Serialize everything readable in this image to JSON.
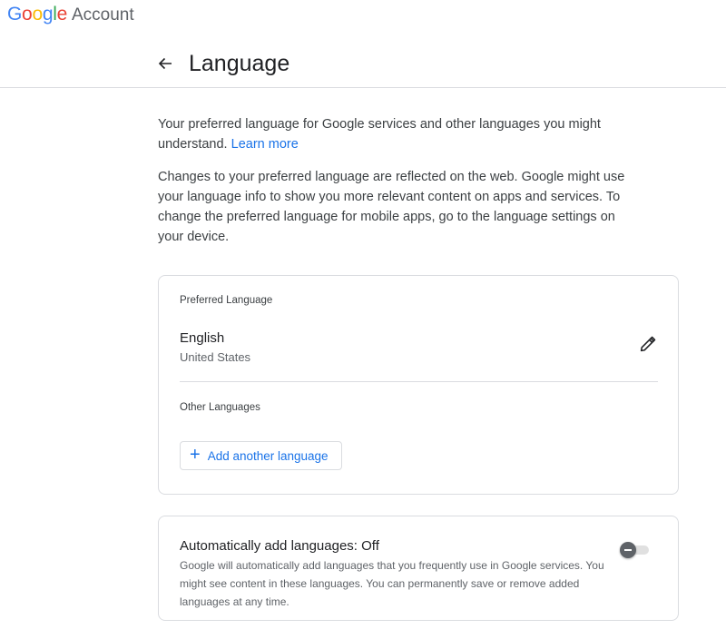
{
  "header": {
    "logo_text": "Google",
    "logo_letters": [
      {
        "char": "G",
        "color": "#4285F4"
      },
      {
        "char": "o",
        "color": "#EA4335"
      },
      {
        "char": "o",
        "color": "#FBBC05"
      },
      {
        "char": "g",
        "color": "#4285F4"
      },
      {
        "char": "l",
        "color": "#34A853"
      },
      {
        "char": "e",
        "color": "#EA4335"
      }
    ],
    "product_name": "Account"
  },
  "page": {
    "title": "Language",
    "back_icon": "arrow-left-icon"
  },
  "intro": {
    "text": "Your preferred language for Google services and other languages you might understand.",
    "link_text": "Learn more",
    "details": "Changes to your preferred language are reflected on the web. Google might use your language info to show you more relevant content on apps and services. To change the preferred language for mobile apps, go to the language settings on your device."
  },
  "preferred_language": {
    "label": "Preferred Language",
    "name": "English",
    "region": "United States",
    "edit_icon": "pencil-icon"
  },
  "other_languages": {
    "label": "Other Languages",
    "add_button_label": "Add another language",
    "add_icon": "plus-icon"
  },
  "auto_add": {
    "title": "Automatically add languages: Off",
    "description": "Google will automatically add languages that you frequently use in Google services. You might see content in these languages. You can permanently save or remove added languages at any time.",
    "enabled": false
  },
  "colors": {
    "accent": "#1a73e8",
    "text_primary": "#202124",
    "text_secondary": "#5f6368",
    "border": "#dadce0"
  }
}
